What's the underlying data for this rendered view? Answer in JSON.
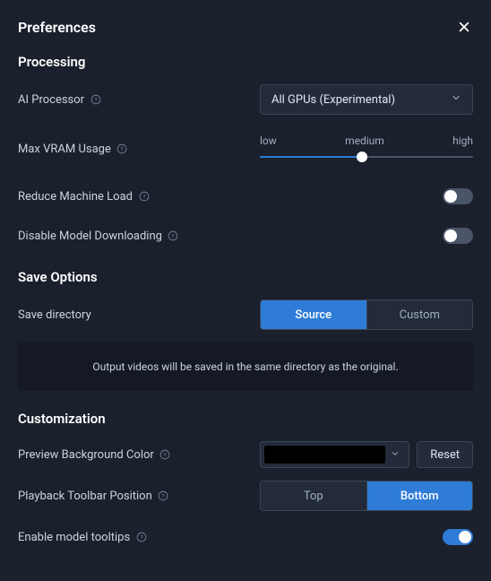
{
  "header": {
    "title": "Preferences"
  },
  "processing": {
    "section": "Processing",
    "ai_processor": {
      "label": "AI Processor",
      "value": "All GPUs (Experimental)"
    },
    "vram": {
      "label": "Max VRAM Usage",
      "ticks": {
        "low": "low",
        "medium": "medium",
        "high": "high"
      }
    },
    "reduce_load": {
      "label": "Reduce Machine Load",
      "on": false
    },
    "disable_download": {
      "label": "Disable Model Downloading",
      "on": false
    }
  },
  "save": {
    "section": "Save Options",
    "directory": {
      "label": "Save directory",
      "source": "Source",
      "custom": "Custom",
      "active": "Source"
    },
    "info": "Output videos will be saved in the same directory as the original."
  },
  "custom": {
    "section": "Customization",
    "bg_color": {
      "label": "Preview Background Color",
      "reset": "Reset",
      "color": "#000000"
    },
    "toolbar_pos": {
      "label": "Playback Toolbar Position",
      "top": "Top",
      "bottom": "Bottom",
      "active": "Bottom"
    },
    "tooltips": {
      "label": "Enable model tooltips",
      "on": true
    }
  }
}
